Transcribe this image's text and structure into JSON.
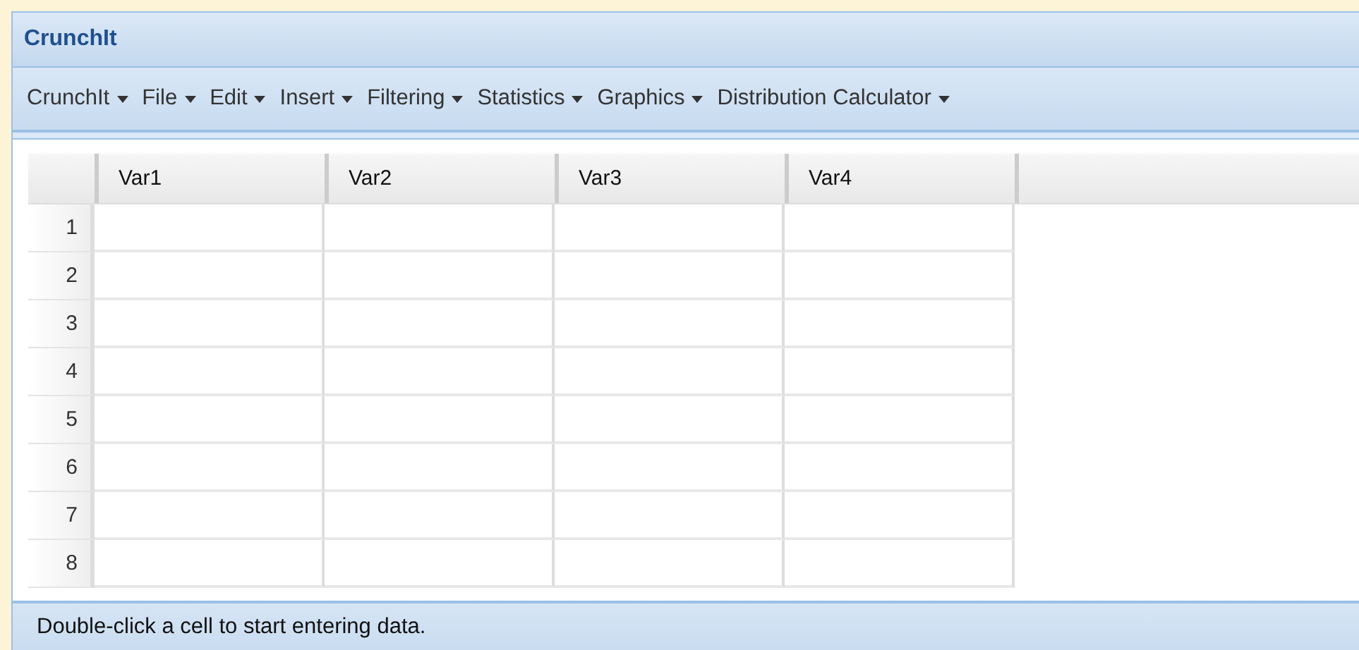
{
  "window": {
    "title": "CrunchIt"
  },
  "menu": [
    {
      "label": "CrunchIt"
    },
    {
      "label": "File"
    },
    {
      "label": "Edit"
    },
    {
      "label": "Insert"
    },
    {
      "label": "Filtering"
    },
    {
      "label": "Statistics"
    },
    {
      "label": "Graphics"
    },
    {
      "label": "Distribution Calculator"
    }
  ],
  "table": {
    "columns": [
      "Var1",
      "Var2",
      "Var3",
      "Var4"
    ],
    "rows": [
      {
        "number": "1"
      },
      {
        "number": "2"
      },
      {
        "number": "3"
      },
      {
        "number": "4"
      },
      {
        "number": "5"
      },
      {
        "number": "6"
      },
      {
        "number": "7"
      },
      {
        "number": "8"
      }
    ]
  },
  "status_bar": "Double-click a cell to start entering data."
}
